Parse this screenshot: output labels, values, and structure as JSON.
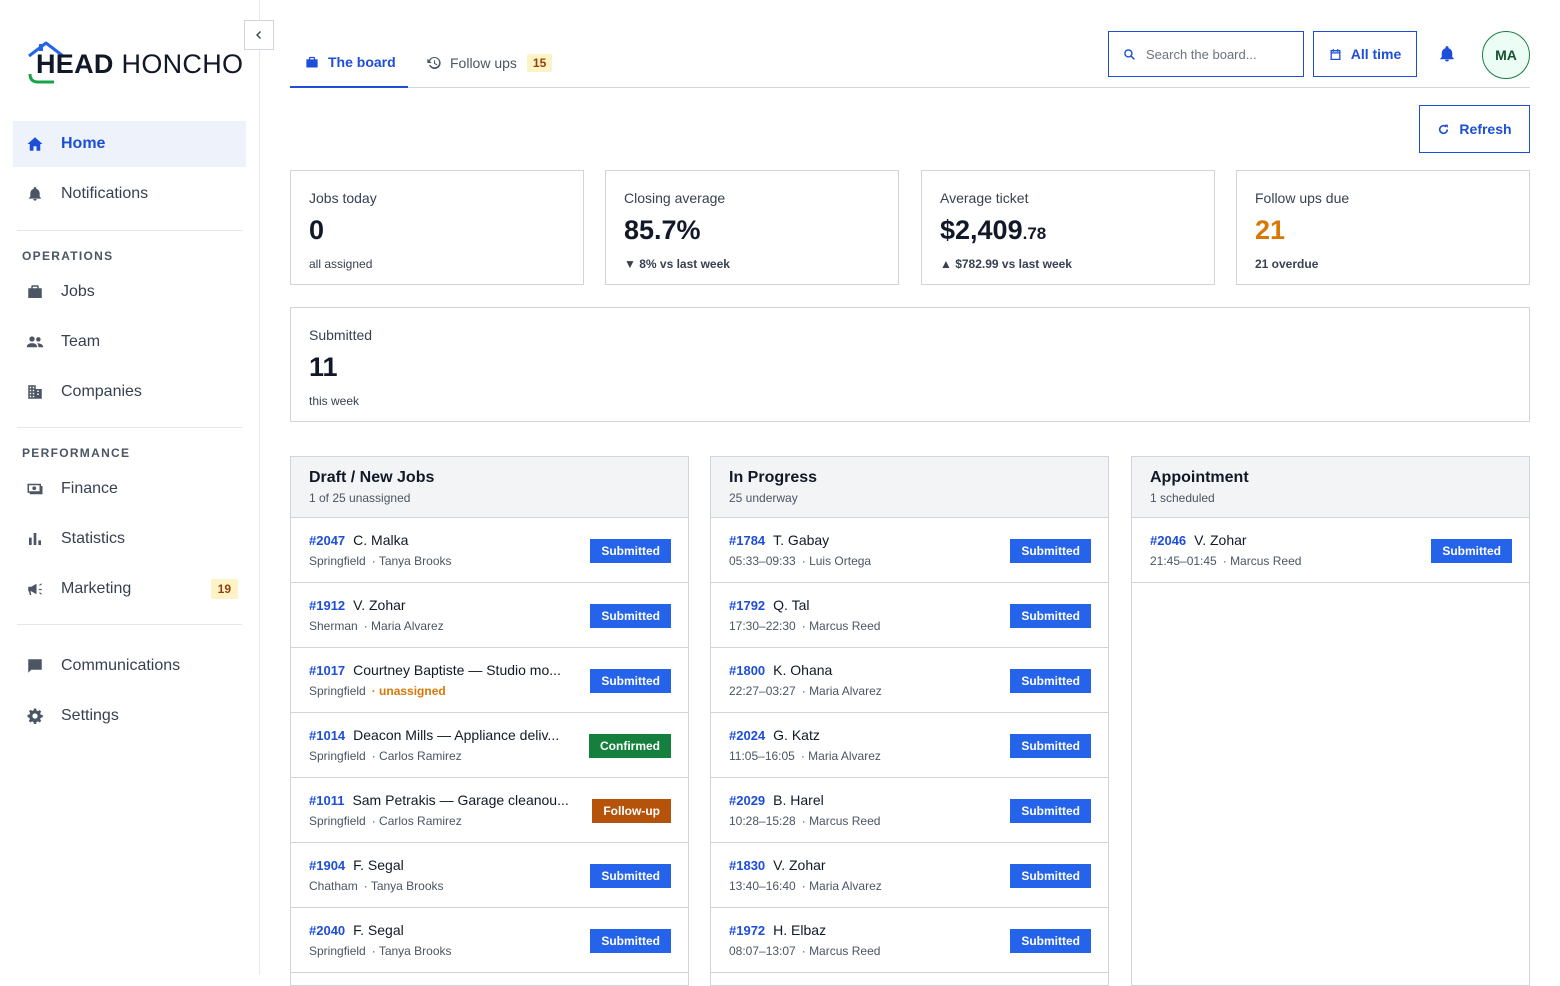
{
  "brand": {
    "logo_bold": "HEAD",
    "logo_rest": " HONCHO"
  },
  "sidebar": {
    "items_top": [
      {
        "label": "Home",
        "icon": "home-icon",
        "active": true
      },
      {
        "label": "Notifications",
        "icon": "bell-icon"
      }
    ],
    "operations_label": "OPERATIONS",
    "operations": [
      {
        "label": "Jobs",
        "icon": "briefcase-icon"
      },
      {
        "label": "Team",
        "icon": "team-icon"
      },
      {
        "label": "Companies",
        "icon": "building-icon"
      }
    ],
    "performance_label": "PERFORMANCE",
    "performance": [
      {
        "label": "Finance",
        "icon": "finance-icon"
      },
      {
        "label": "Statistics",
        "icon": "bar-chart-icon"
      },
      {
        "label": "Marketing",
        "icon": "megaphone-icon",
        "badge": "19"
      }
    ],
    "bottom": [
      {
        "label": "Communications",
        "icon": "chat-icon"
      },
      {
        "label": "Settings",
        "icon": "gear-icon"
      }
    ]
  },
  "tabs": [
    {
      "label": "The board",
      "icon": "briefcase-icon",
      "active": true
    },
    {
      "label": "Follow ups",
      "icon": "history-icon",
      "badge": "15"
    }
  ],
  "search": {
    "placeholder": "Search the board..."
  },
  "filter": {
    "label": "All time"
  },
  "user": {
    "initials": "MA"
  },
  "refresh_label": "Refresh",
  "stats": [
    {
      "label": "Jobs today",
      "value": "0",
      "sub": "all assigned"
    },
    {
      "label": "Closing average",
      "value": "85.7%",
      "sub": "▼ 8% vs last week",
      "trend": "down"
    },
    {
      "label": "Average ticket",
      "value_main": "$2,409",
      "value_cents": ".78",
      "sub": "▲ $782.99 vs last week",
      "trend": "up"
    },
    {
      "label": "Follow ups due",
      "value": "21",
      "sub": "21 overdue",
      "accent": "#d97706"
    },
    {
      "label": "Submitted",
      "value": "11",
      "sub": "this week"
    }
  ],
  "colors": {
    "primary": "#1d4ed8",
    "submitted": "#2563eb",
    "confirmed": "#15803d",
    "followup": "#b45309",
    "warning": "#d97706",
    "danger": "#dc2626"
  },
  "columns": [
    {
      "title": "Draft / New Jobs",
      "subtitle": "1 of 25 unassigned",
      "jobs": [
        {
          "id": "#2047",
          "name": "C. Malka",
          "place": "Springfield",
          "who": "· Tanya Brooks",
          "status": "Submitted"
        },
        {
          "id": "#1912",
          "name": "V. Zohar",
          "place": "Sherman",
          "who": "· Maria Alvarez",
          "status": "Submitted"
        },
        {
          "id": "#1017",
          "name": "Courtney Baptiste — Studio mo...",
          "place": "Springfield",
          "who": "· unassigned",
          "status": "Submitted"
        },
        {
          "id": "#1014",
          "name": "Deacon Mills — Appliance deliv...",
          "place": "Springfield",
          "who": "· Carlos Ramirez",
          "status": "Confirmed"
        },
        {
          "id": "#1011",
          "name": "Sam Petrakis — Garage cleanou...",
          "place": "Springfield",
          "who": "· Carlos Ramirez",
          "status": "Follow-up"
        },
        {
          "id": "#1904",
          "name": "F. Segal",
          "place": "Chatham",
          "who": "· Tanya Brooks",
          "status": "Submitted"
        },
        {
          "id": "#2040",
          "name": "F. Segal",
          "place": "Springfield",
          "who": "· Tanya Brooks",
          "status": "Submitted"
        }
      ]
    },
    {
      "title": "In Progress",
      "subtitle": "25 underway",
      "jobs": [
        {
          "id": "#1784",
          "name": "T. Gabay",
          "place": "05:33–09:33",
          "who": "· Luis Ortega",
          "status": "Submitted"
        },
        {
          "id": "#1792",
          "name": "Q. Tal",
          "place": "17:30–22:30",
          "who": "· Marcus Reed",
          "status": "Submitted"
        },
        {
          "id": "#1800",
          "name": "K. Ohana",
          "place": "22:27–03:27",
          "who": "· Maria Alvarez",
          "status": "Submitted"
        },
        {
          "id": "#2024",
          "name": "G. Katz",
          "place": "11:05–16:05",
          "who": "· Maria Alvarez",
          "status": "Submitted"
        },
        {
          "id": "#2029",
          "name": "B. Harel",
          "place": "10:28–15:28",
          "who": "· Marcus Reed",
          "status": "Submitted"
        },
        {
          "id": "#1830",
          "name": "V. Zohar",
          "place": "13:40–16:40",
          "who": "· Maria Alvarez",
          "status": "Submitted"
        },
        {
          "id": "#1972",
          "name": "H. Elbaz",
          "place": "08:07–13:07",
          "who": "· Marcus Reed",
          "status": "Submitted"
        }
      ]
    },
    {
      "title": "Appointment",
      "subtitle": "1 scheduled",
      "jobs": [
        {
          "id": "#2046",
          "name": "V. Zohar",
          "place": "21:45–01:45",
          "who": "· Marcus Reed",
          "status": "Submitted"
        }
      ]
    }
  ]
}
